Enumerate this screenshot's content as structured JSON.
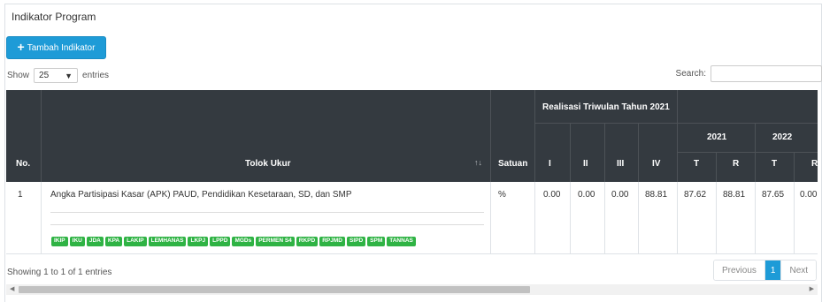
{
  "card": {
    "title": "Indikator Program"
  },
  "toolbar": {
    "add_label": "Tambah Indikator"
  },
  "length": {
    "show": "Show",
    "value": "25",
    "entries": "entries"
  },
  "search": {
    "label": "Search:",
    "value": ""
  },
  "table": {
    "headers": {
      "no": "No.",
      "tolok_ukur": "Tolok Ukur",
      "satuan": "Satuan",
      "realisasi": "Realisasi Triwulan Tahun 2021",
      "q1": "I",
      "q2": "II",
      "q3": "III",
      "q4": "IV",
      "year_2021": "2021",
      "year_2022": "2022",
      "t": "T",
      "r": "R",
      "sort_icon": "↑↓"
    },
    "rows": [
      {
        "no": "1",
        "tolok_ukur": "Angka Partisipasi Kasar (APK) PAUD, Pendidikan Kesetaraan, SD, dan SMP",
        "satuan": "%",
        "q1": "0.00",
        "q2": "0.00",
        "q3": "0.00",
        "q4": "88.81",
        "t2021": "87.62",
        "r2021": "88.81",
        "t2022": "87.65",
        "r2022": "0.00",
        "tags": [
          "IKIP",
          "IKU",
          "JDA",
          "KPA",
          "LAKIP",
          "LEMHANAS",
          "LKPJ",
          "LPPD",
          "MGDs",
          "PERMEN S4",
          "RKPD",
          "RPJMD",
          "SIPD",
          "SPM",
          "TANNAS"
        ]
      }
    ]
  },
  "footer": {
    "info": "Showing 1 to 1 of 1 entries",
    "previous": "Previous",
    "page": "1",
    "next": "Next"
  },
  "colors": {
    "header_bg": "#343a40",
    "primary": "#1e9bd7",
    "tag_green": "#2fb344"
  }
}
